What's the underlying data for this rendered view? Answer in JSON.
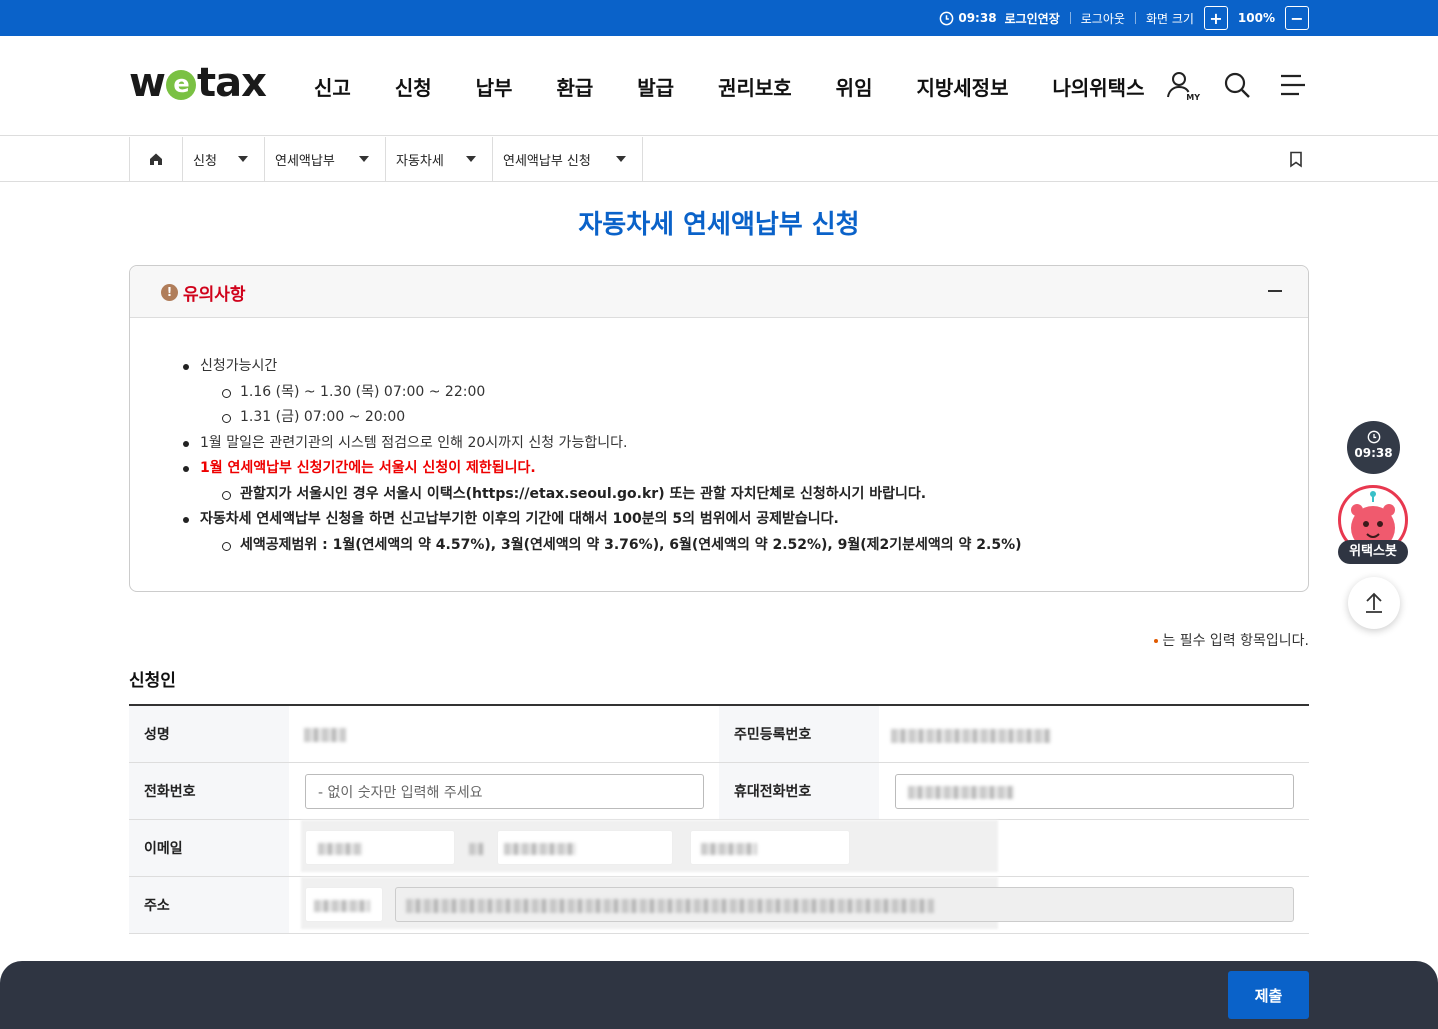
{
  "topbar": {
    "time": "09:38",
    "extend_login": "로그인연장",
    "logout": "로그아웃",
    "screen_size_label": "화면 크기",
    "zoom_in": "+",
    "zoom_level": "100%",
    "zoom_out": "−"
  },
  "header": {
    "logo_text_pre": "w",
    "logo_text_e": "e",
    "logo_text_post": "tax",
    "nav": [
      "신고",
      "신청",
      "납부",
      "환급",
      "발급",
      "권리보호",
      "위임",
      "지방세정보",
      "나의위택스"
    ],
    "my_label": "MY"
  },
  "breadcrumb": {
    "items": [
      "신청",
      "연세액납부",
      "자동차세",
      "연세액납부 신청"
    ]
  },
  "page_title": "자동차세 연세액납부 신청",
  "notice": {
    "title": "유의사항",
    "items": [
      {
        "level": 1,
        "style": "normal",
        "text": "신청가능시간"
      },
      {
        "level": 2,
        "style": "normal",
        "text": "1.16 (목) ~ 1.30 (목) 07:00 ~ 22:00"
      },
      {
        "level": 2,
        "style": "normal",
        "text": "1.31 (금) 07:00 ~ 20:00"
      },
      {
        "level": 1,
        "style": "normal",
        "text": "1월 말일은 관련기관의 시스템 점검으로 인해 20시까지 신청 가능합니다."
      },
      {
        "level": 1,
        "style": "red",
        "text": "1월 연세액납부 신청기간에는 서울시 신청이 제한됩니다."
      },
      {
        "level": 2,
        "style": "bold",
        "text": "관할지가 서울시인 경우 서울시 이택스(https://etax.seoul.go.kr) 또는 관할 자치단체로 신청하시기 바랍니다."
      },
      {
        "level": 1,
        "style": "bold",
        "text": "자동차세 연세액납부 신청을 하면 신고납부기한 이후의 기간에 대해서 100분의 5의 범위에서 공제받습니다."
      },
      {
        "level": 2,
        "style": "bold",
        "text": "세액공제범위 : 1월(연세액의 약 4.57%), 3월(연세액의 약 3.76%), 6월(연세액의 약 2.52%), 9월(제2기분세액의 약 2.5%)"
      }
    ]
  },
  "required_note": "는 필수 입력 항목입니다.",
  "applicant": {
    "section_title": "신청인",
    "name_label": "성명",
    "rrn_label": "주민등록번호",
    "phone_label": "전화번호",
    "phone_placeholder": "- 없이 숫자만 입력해 주세요",
    "mobile_label": "휴대전화번호",
    "email_label": "이메일",
    "address_label": "주소"
  },
  "floating": {
    "time": "09:38",
    "bot_label": "위택스봇"
  },
  "submit_label": "제출",
  "colors": {
    "brand_blue": "#0a62c9",
    "notice_red": "#d0021b",
    "bottom_bar": "#2f3542"
  }
}
